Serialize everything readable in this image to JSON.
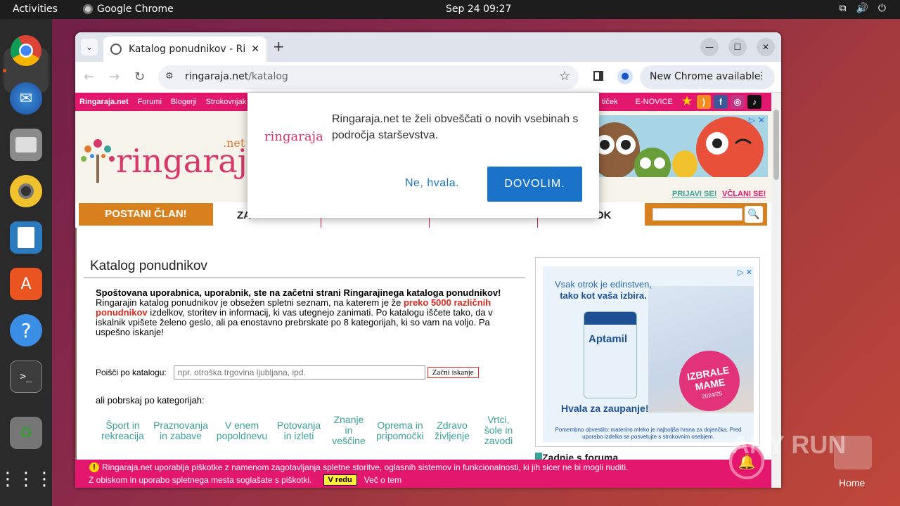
{
  "os": {
    "activities": "Activities",
    "app_name": "Google Chrome",
    "clock": "Sep 24  09:27",
    "home_label": "Home",
    "watermark": "ANY RUN"
  },
  "dock": {
    "items": [
      "chrome-icon",
      "thunderbird-icon",
      "files-icon",
      "rhythmbox-icon",
      "writer-icon",
      "software-icon",
      "help-icon",
      "terminal-icon",
      "trash-icon",
      "apps-grid-icon"
    ]
  },
  "browser": {
    "tab_title": "Katalog ponudnikov - Ringaraja.net",
    "url_host": "ringaraja.net",
    "url_path": "/katalog",
    "update_label": "New Chrome available"
  },
  "site": {
    "topnav": [
      "Ringaraja.net",
      "Forumi",
      "Blogerji",
      "Strokovnjak"
    ],
    "topnav_right": [
      "tiček",
      "E-NOVICE"
    ],
    "logo": "ringaraja",
    "logo_net": ".net",
    "login": "PRIJAVI SE!",
    "register": "VČLANI SE!",
    "member_button": "POSTANI ČLAN!",
    "menu_left": "ZA",
    "menu_right": "OK",
    "page_title": "Katalog ponudnikov",
    "intro_bold": "Spoštovana uporabnica, uporabnik, ste na začetni strani Ringarajinega kataloga ponudnikov!",
    "intro_1": "Ringarajin katalog ponudnikov je obsežen spletni seznam, na katerem je že ",
    "intro_red": "preko 5000 različnih ponudnikov",
    "intro_2": " izdelkov, storitev in informacij, ki vas utegnejo zanimati. Po katalogu iščete tako, da v iskalnik vpišete želeno geslo, ali pa enostavno prebrskate po 8 kategorijah, ki so vam na voljo. Pa uspešno iskanje!",
    "search_label": "Poišči po katalogu:",
    "search_placeholder": "npr. otroška trgovina ljubljana, ipd.",
    "search_button": "Začni iskanje",
    "categories_label": "ali pobrskaj po kategorijah:",
    "categories": [
      {
        "l1": "Šport in",
        "l2": "rekreacija",
        "l3": ""
      },
      {
        "l1": "Praznovanja",
        "l2": "in zabave",
        "l3": ""
      },
      {
        "l1": "V enem",
        "l2": "popoldnevu",
        "l3": ""
      },
      {
        "l1": "Potovanja",
        "l2": "in izleti",
        "l3": ""
      },
      {
        "l1": "Znanje",
        "l2": "in",
        "l3": "veščine"
      },
      {
        "l1": "Oprema in",
        "l2": "pripomočki",
        "l3": ""
      },
      {
        "l1": "Zdravo",
        "l2": "življenje",
        "l3": ""
      },
      {
        "l1": "Vrtci,",
        "l2": "šole in",
        "l3": "zavodi"
      }
    ],
    "forum_heading": "Zadnje s foruma",
    "cookie_line1": "Ringaraja.net uporablja piškotke z namenom zagotavljanja spletne storitve, oglasnih sistemov in funkcionalnosti, ki jih sicer ne bi mogli nuditi.",
    "cookie_line2": "Z obiskom in uporabo spletnega mesta soglašate s piškotki.",
    "cookie_ok": "V redu",
    "cookie_more": "Več o tem"
  },
  "ad": {
    "line1": "Vsak otrok je edinstven,",
    "line2": "tako kot vaša izbira.",
    "product": "Aptamil",
    "thanks": "Hvala za zaupanje!",
    "badge1": "IZBRALE",
    "badge2": "MAME",
    "badge3": "2024/25",
    "note": "Pomembno obvestilo: materino mleko je najboljša hrana za dojenčka. Pred uporabo izdelka se posvetujte s strokovnim osebjem."
  },
  "popup": {
    "logo": "ringaraja",
    "message": "Ringaraja.net te želi obveščati o novih vsebinah s področja starševstva.",
    "deny": "Ne, hvala.",
    "allow": "DOVOLIM."
  },
  "colors": {
    "brand_pink": "#e3176d",
    "brand_orange": "#d9801e",
    "link_teal": "#3aa199",
    "popup_blue": "#1a73c8"
  }
}
